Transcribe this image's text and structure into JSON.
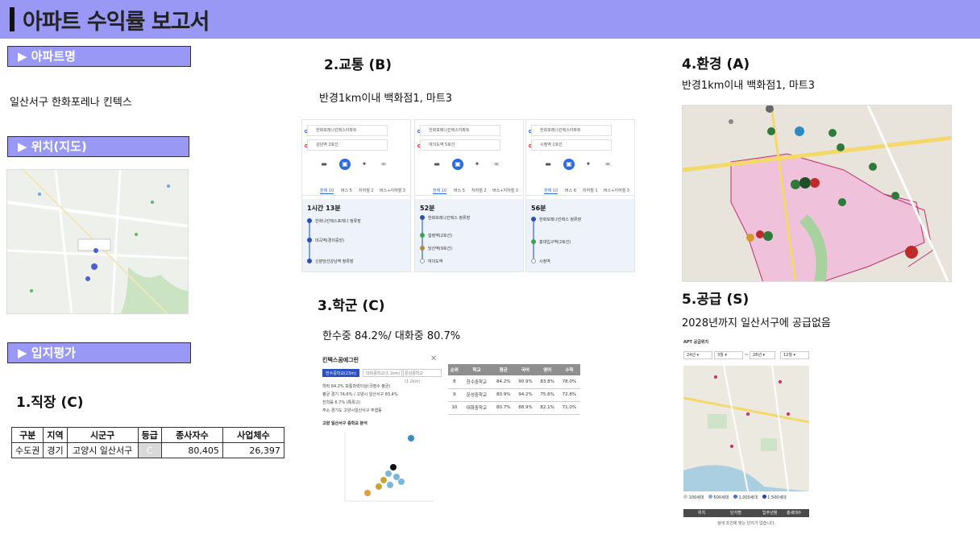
{
  "header": {
    "title": "아파트 수익률 보고서"
  },
  "sections": {
    "apartment_name": "▶  아파트명",
    "location_map": "▶  위치(지도)",
    "site_eval": "▶  입지평가"
  },
  "apartment": {
    "name": "일산서구 한화포레나 킨텍스"
  },
  "job": {
    "heading": "1.직장 (C)",
    "headers": [
      "구분",
      "지역",
      "시군구",
      "등급",
      "종사자수",
      "사업체수"
    ],
    "row": [
      "수도권",
      "경기",
      "고양시 일산서구",
      "C",
      "80,405",
      "26,397"
    ]
  },
  "transport": {
    "heading": "2.교통 (B)",
    "desc": "반경1km이내 백화점1, 마트3",
    "panels": [
      {
        "from": "한화포레나킨텍스아파트",
        "to": "강남역 2호선",
        "time": "1시간 13분",
        "steps": [
          "한화나킨텍스포레나 정류장",
          "대곡역(경의중앙)",
          "신분당선강남역 정류장"
        ],
        "tabs": [
          "전체 10",
          "버스 5",
          "지하철 2",
          "버스+지하철 3"
        ]
      },
      {
        "from": "한화포레나킨텍스아파트",
        "to": "여의도역 5호선",
        "time": "52분",
        "steps": [
          "한화포레나킨텍스 정류장",
          "합정역(2호선)",
          "당산역(9호선)",
          "여의도역"
        ],
        "tabs": [
          "전체 10",
          "버스 5",
          "지하철 2",
          "버스+지하철 3"
        ]
      },
      {
        "from": "한화포레나킨텍스아파트",
        "to": "시청역 1호선",
        "time": "56분",
        "steps": [
          "한화포레나킨텍스 정류장",
          "홍대입구역(2호선)",
          "시청역"
        ],
        "tabs": [
          "전체 10",
          "버스 6",
          "지하철 1",
          "버스+지하철 3"
        ]
      }
    ]
  },
  "school": {
    "heading": "3.학군 (C)",
    "desc": "한수중 84.2%/ 대화중 80.7%",
    "panel_title": "킨텍스꿈에그린",
    "pills": [
      "한수중학교(23m)",
      "대화중학교(1.1km)",
      "문성중학교(1.2km)"
    ],
    "info": [
      "학력 84.2% 보통학력이상(국영수 평균)",
      "평균 경기 74.6% / 고양시 일산서구 83.4%",
      "진학률 6.7% (특목고)",
      "주소 경기도 고양시일산서구 주엽동"
    ],
    "chart_label": "고양 일산서구 중학교 분석",
    "table_headers": [
      "순위",
      "학교",
      "평균",
      "국어",
      "영어",
      "수학"
    ],
    "table_rows": [
      [
        "8",
        "한수중학교",
        "84.2%",
        "90.9%",
        "83.8%",
        "78.0%"
      ],
      [
        "9",
        "문성중학교",
        "80.9%",
        "94.2%",
        "75.6%",
        "72.8%"
      ],
      [
        "10",
        "대화중학교",
        "80.7%",
        "88.9%",
        "82.1%",
        "71.0%"
      ]
    ]
  },
  "environment": {
    "heading": "4.환경 (A)",
    "desc": "반경1km이내 백화점1, 마트3"
  },
  "supply": {
    "heading": "5.공급 (S)",
    "desc": "2028년까지 일산서구에 공급없음",
    "panel_title": "APT 공급위치",
    "selects": [
      "24년",
      "3월",
      "28년",
      "12월"
    ],
    "legend": [
      "100세대",
      "500세대",
      "1,000세대",
      "1,500세대"
    ],
    "table_headers": [
      "위치",
      "단지명",
      "입주년월",
      "총세대수"
    ],
    "empty_msg": "검색 조건에 맞는 단지가 없습니다."
  }
}
